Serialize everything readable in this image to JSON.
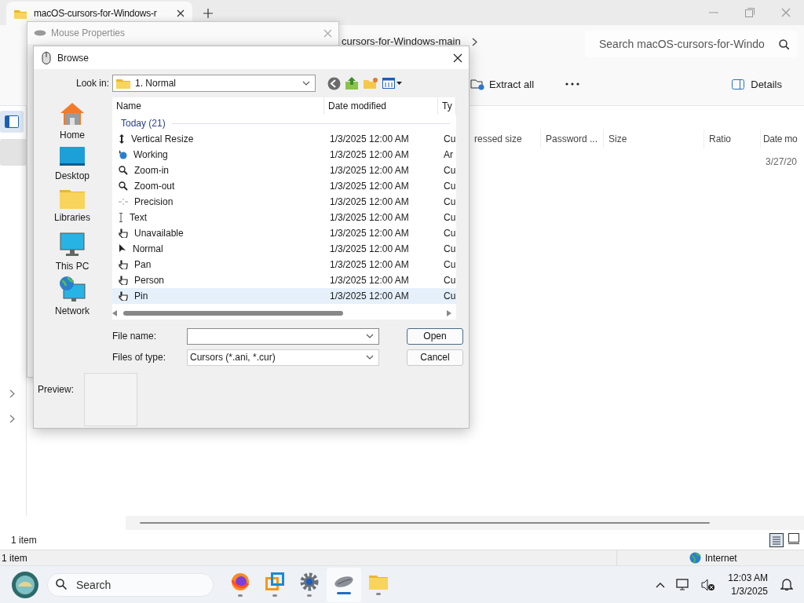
{
  "explorer": {
    "tab_title": "macOS-cursors-for-Windows-r",
    "breadcrumb": "cursors-for-Windows-main",
    "search_placeholder": "Search macOS-cursors-for-Windo",
    "toolbar": [
      "Extract all"
    ],
    "details": "Details",
    "columns": [
      "ressed size",
      "Password ...",
      "Size",
      "Ratio",
      "Date mo"
    ],
    "rows": [
      [
        "",
        "",
        "",
        "",
        "3/27/20"
      ]
    ],
    "status": "1 item"
  },
  "mouse_properties": {
    "title": "Mouse Properties"
  },
  "browse": {
    "title": "Browse",
    "look_in_label": "Look in:",
    "look_in": "1. Normal",
    "places": [
      {
        "label": "Home",
        "kind": "home"
      },
      {
        "label": "Desktop",
        "kind": "desktop"
      },
      {
        "label": "Libraries",
        "kind": "libraries"
      },
      {
        "label": "This PC",
        "kind": "pc"
      },
      {
        "label": "Network",
        "kind": "network"
      }
    ],
    "columns": [
      "Name",
      "Date modified",
      "Ty"
    ],
    "group": "Today (21)",
    "files": [
      {
        "name": "Vertical Resize",
        "date": "1/3/2025 12:00 AM",
        "type": "Cu",
        "kind": "resize",
        "selected": false
      },
      {
        "name": "Working",
        "date": "1/3/2025 12:00 AM",
        "type": "Ar",
        "kind": "busy",
        "selected": false
      },
      {
        "name": "Zoom-in",
        "date": "1/3/2025 12:00 AM",
        "type": "Cu",
        "kind": "zoom",
        "selected": false
      },
      {
        "name": "Zoom-out",
        "date": "1/3/2025 12:00 AM",
        "type": "Cu",
        "kind": "zoom",
        "selected": false
      },
      {
        "name": "Precision",
        "date": "1/3/2025 12:00 AM",
        "type": "Cu",
        "kind": "cross",
        "selected": false
      },
      {
        "name": "Text",
        "date": "1/3/2025 12:00 AM",
        "type": "Cu",
        "kind": "ibeam",
        "selected": false
      },
      {
        "name": "Unavailable",
        "date": "1/3/2025 12:00 AM",
        "type": "Cu",
        "kind": "hand",
        "selected": false
      },
      {
        "name": "Normal",
        "date": "1/3/2025 12:00 AM",
        "type": "Cu",
        "kind": "arrow",
        "selected": false
      },
      {
        "name": "Pan",
        "date": "1/3/2025 12:00 AM",
        "type": "Cu",
        "kind": "hand",
        "selected": false
      },
      {
        "name": "Person",
        "date": "1/3/2025 12:00 AM",
        "type": "Cu",
        "kind": "hand",
        "selected": false
      },
      {
        "name": "Pin",
        "date": "1/3/2025 12:00 AM",
        "type": "Cu",
        "kind": "hand",
        "selected": true
      }
    ],
    "file_name_label": "File name:",
    "files_of_type_label": "Files of type:",
    "files_of_type": "Cursors (*.ani, *.cur)",
    "buttons": [
      "Open",
      "Cancel"
    ],
    "preview_label": "Preview:"
  },
  "browser_status": {
    "text": "1 item",
    "zone": "Internet"
  },
  "taskbar": {
    "search_placeholder": "Search",
    "apps": [
      {
        "kind": "firefox",
        "active": false
      },
      {
        "kind": "squares",
        "active": false
      },
      {
        "kind": "gear",
        "active": false
      },
      {
        "kind": "mouse",
        "active": true
      },
      {
        "kind": "folder",
        "active": false
      }
    ],
    "time": "12:03 AM",
    "date": "1/3/2025"
  }
}
